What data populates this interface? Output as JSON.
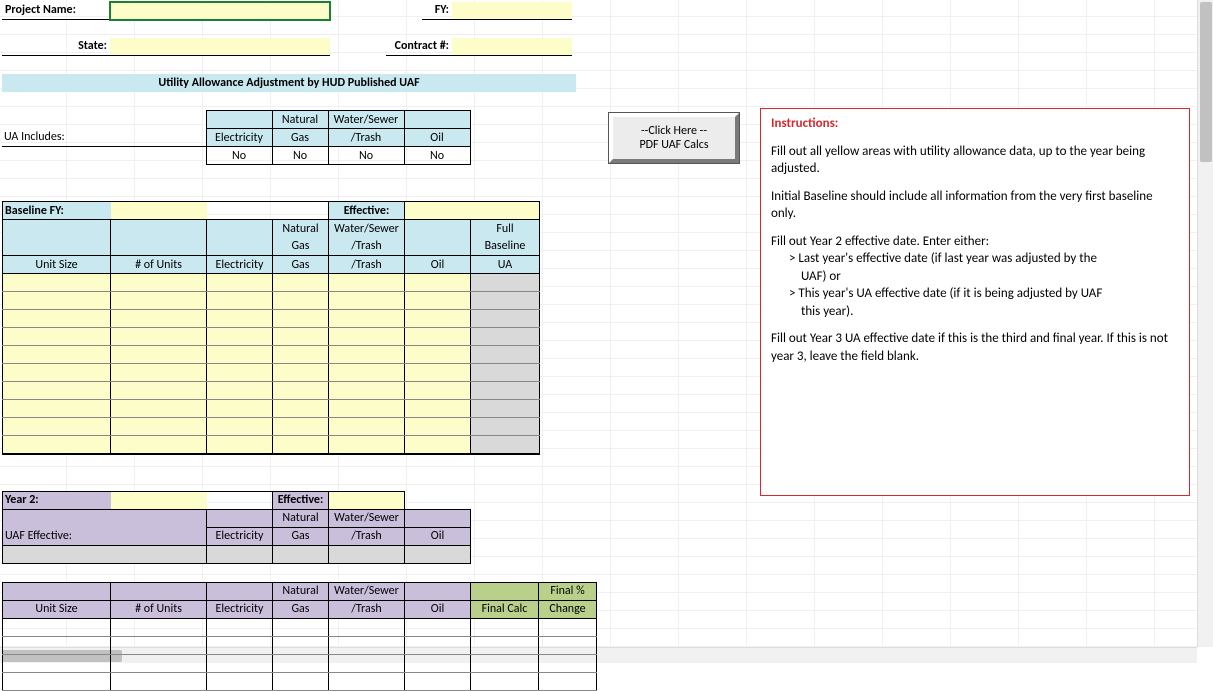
{
  "header": {
    "project_name_label": "Project Name:",
    "project_name_value": "",
    "fy_label": "FY:",
    "fy_value": "",
    "state_label": "State:",
    "state_value": "",
    "contract_label": "Contract #:",
    "contract_value": ""
  },
  "title": "Utility Allowance Adjustment by HUD Published UAF",
  "ua_includes": {
    "label": "UA Includes:",
    "cols": [
      "Electricity",
      "Natural Gas",
      "Water/Sewer /Trash",
      "Oil"
    ],
    "values": [
      "No",
      "No",
      "No",
      "No"
    ]
  },
  "pdf_button": {
    "line1": "--Click Here --",
    "line2": "PDF UAF Calcs"
  },
  "instructions": {
    "title": "Instructions:",
    "p1": "Fill out all yellow areas with utility allowance data, up to the year being adjusted.",
    "p2": "Initial Baseline should include all information from the very first baseline only.",
    "p3": "Fill out Year 2 effective date.  Enter either:",
    "p3a": "> Last year's effective date (if last year was adjusted by the",
    "p3a2": "UAF) or",
    "p3b": "> This year's UA effective date (if it is being adjusted by UAF",
    "p3b2": "this year).",
    "p4": "Fill out Year 3 UA effective date if this is the third and final year.  If this is not year 3, leave the field blank."
  },
  "baseline": {
    "label": "Baseline FY:",
    "fy_value": "",
    "effective_label": "Effective:",
    "effective_value": "",
    "headers": [
      "Unit Size",
      "# of Units",
      "Electricity",
      "Natural Gas",
      "Water/Sewer /Trash",
      "Oil",
      "Full Baseline UA"
    ],
    "rows": 10
  },
  "year2": {
    "label": "Year 2:",
    "effective_label": "Effective:",
    "year_value": "",
    "effective_value": "",
    "uaf_label": "UAF Effective:",
    "uaf_headers": [
      "Electricity",
      "Natural Gas",
      "Water/Sewer /Trash",
      "Oil"
    ],
    "table_headers": [
      "Unit Size",
      "# of Units",
      "Electricity",
      "Natural Gas",
      "Water/Sewer /Trash",
      "Oil",
      "Final Calc",
      "Final % Change"
    ],
    "rows": 4
  }
}
